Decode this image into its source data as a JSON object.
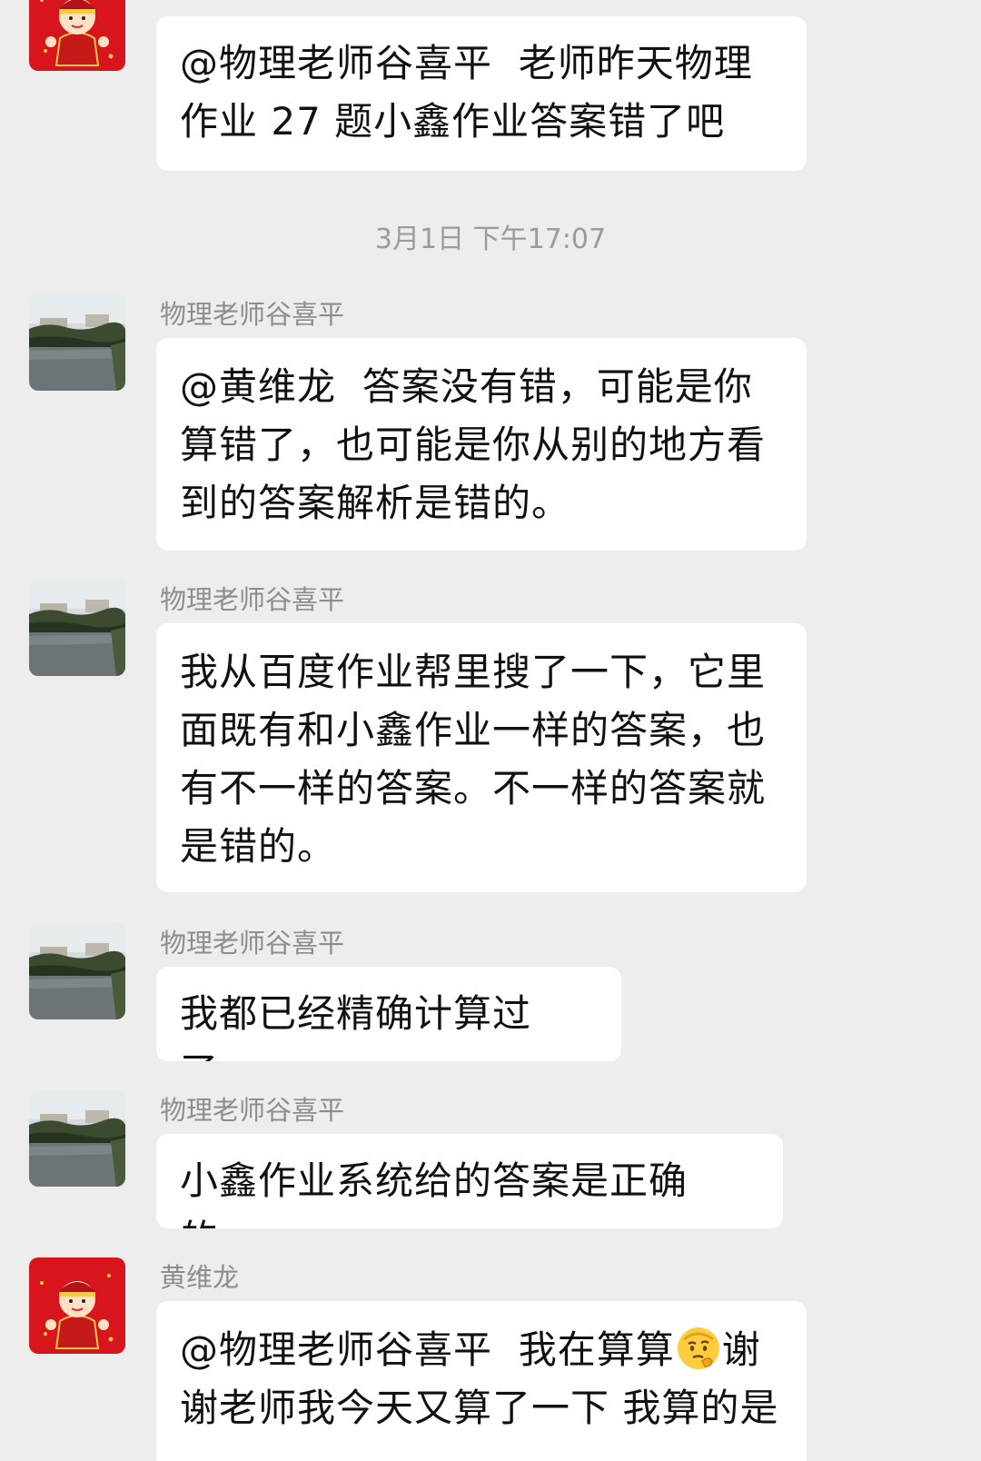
{
  "timestamp": "3月1日 下午17:07",
  "messages": [
    {
      "sender": "",
      "text": "@物理老师谷喜平  老师昨天物理作业 27 题小鑫作业答案错了吧",
      "avatar": "boy-red-avatar-icon"
    },
    {
      "sender": "物理老师谷喜平",
      "text": "@黄维龙  答案没有错，可能是你算错了，也可能是你从别的地方看到的答案解析是错的。",
      "avatar": "lake-photo-avatar-icon"
    },
    {
      "sender": "物理老师谷喜平",
      "text": "我从百度作业帮里搜了一下，它里面既有和小鑫作业一样的答案，也有不一样的答案。不一样的答案就是错的。",
      "avatar": "lake-photo-avatar-icon"
    },
    {
      "sender": "物理老师谷喜平",
      "text": "我都已经精确计算过了。",
      "avatar": "lake-photo-avatar-icon"
    },
    {
      "sender": "物理老师谷喜平",
      "text": "小鑫作业系统给的答案是正确的。",
      "avatar": "lake-photo-avatar-icon"
    },
    {
      "sender": "黄维龙",
      "text_before_emoji": "@物理老师谷喜平  我在算算",
      "emoji": "thinking-face-emoji-icon",
      "text_after_emoji": "谢谢老师我今天又算了一下 我算的是",
      "avatar": "boy-red-avatar-icon"
    }
  ],
  "colors": {
    "background": "#ededed",
    "bubble": "#ffffff",
    "text": "#111111",
    "meta_text": "#8d8d8d",
    "avatar_red": "#d8141c"
  }
}
